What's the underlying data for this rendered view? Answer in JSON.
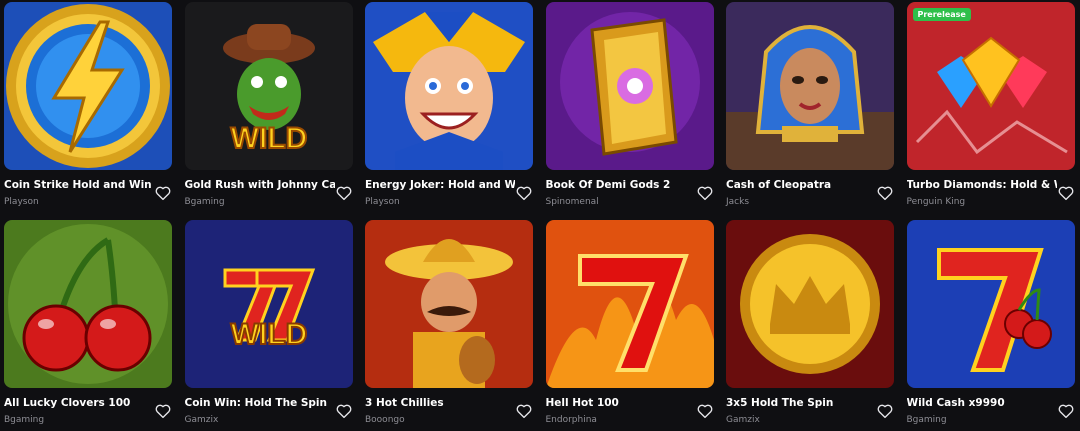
{
  "games": [
    {
      "title": "Coin Strike Hold and Win",
      "provider": "Playson",
      "badge": "",
      "theme": "lightning-coin",
      "bg": "#1d4fb8"
    },
    {
      "title": "Gold Rush with Johnny Cash",
      "provider": "Bgaming",
      "badge": "",
      "theme": "cactus-wild",
      "bg": "#1a1a1c"
    },
    {
      "title": "Energy Joker: Hold and Win",
      "provider": "Playson",
      "badge": "",
      "theme": "joker",
      "bg": "#1f4fc4"
    },
    {
      "title": "Book Of Demi Gods 2",
      "provider": "Spinomenal",
      "badge": "",
      "theme": "golden-book",
      "bg": "#5a1a8a"
    },
    {
      "title": "Cash of Cleopatra",
      "provider": "Jacks",
      "badge": "",
      "theme": "cleopatra",
      "bg": "#3b2a5c"
    },
    {
      "title": "Turbo Diamonds: Hold & Win",
      "provider": "Penguin King",
      "badge": "Prerelease",
      "theme": "diamonds",
      "bg": "#c0252b"
    },
    {
      "title": "All Lucky Clovers 100",
      "provider": "Bgaming",
      "badge": "",
      "theme": "cherries",
      "bg": "#4c7a1e"
    },
    {
      "title": "Coin Win: Hold The Spin",
      "provider": "Gamzix",
      "badge": "",
      "theme": "seven-wild",
      "bg": "#1d2377"
    },
    {
      "title": "3 Hot Chillies",
      "provider": "Booongo",
      "badge": "",
      "theme": "mariachi",
      "bg": "#b52d10"
    },
    {
      "title": "Hell Hot 100",
      "provider": "Endorphina",
      "badge": "",
      "theme": "fire-seven",
      "bg": "#e0520f"
    },
    {
      "title": "3x5 Hold The Spin",
      "provider": "Gamzix",
      "badge": "",
      "theme": "crown-coin",
      "bg": "#6a0d0d"
    },
    {
      "title": "Wild Cash x9990",
      "provider": "Bgaming",
      "badge": "",
      "theme": "seven-cherry",
      "bg": "#1c3fb5"
    }
  ],
  "favorite_icon": "heart-outline-icon"
}
